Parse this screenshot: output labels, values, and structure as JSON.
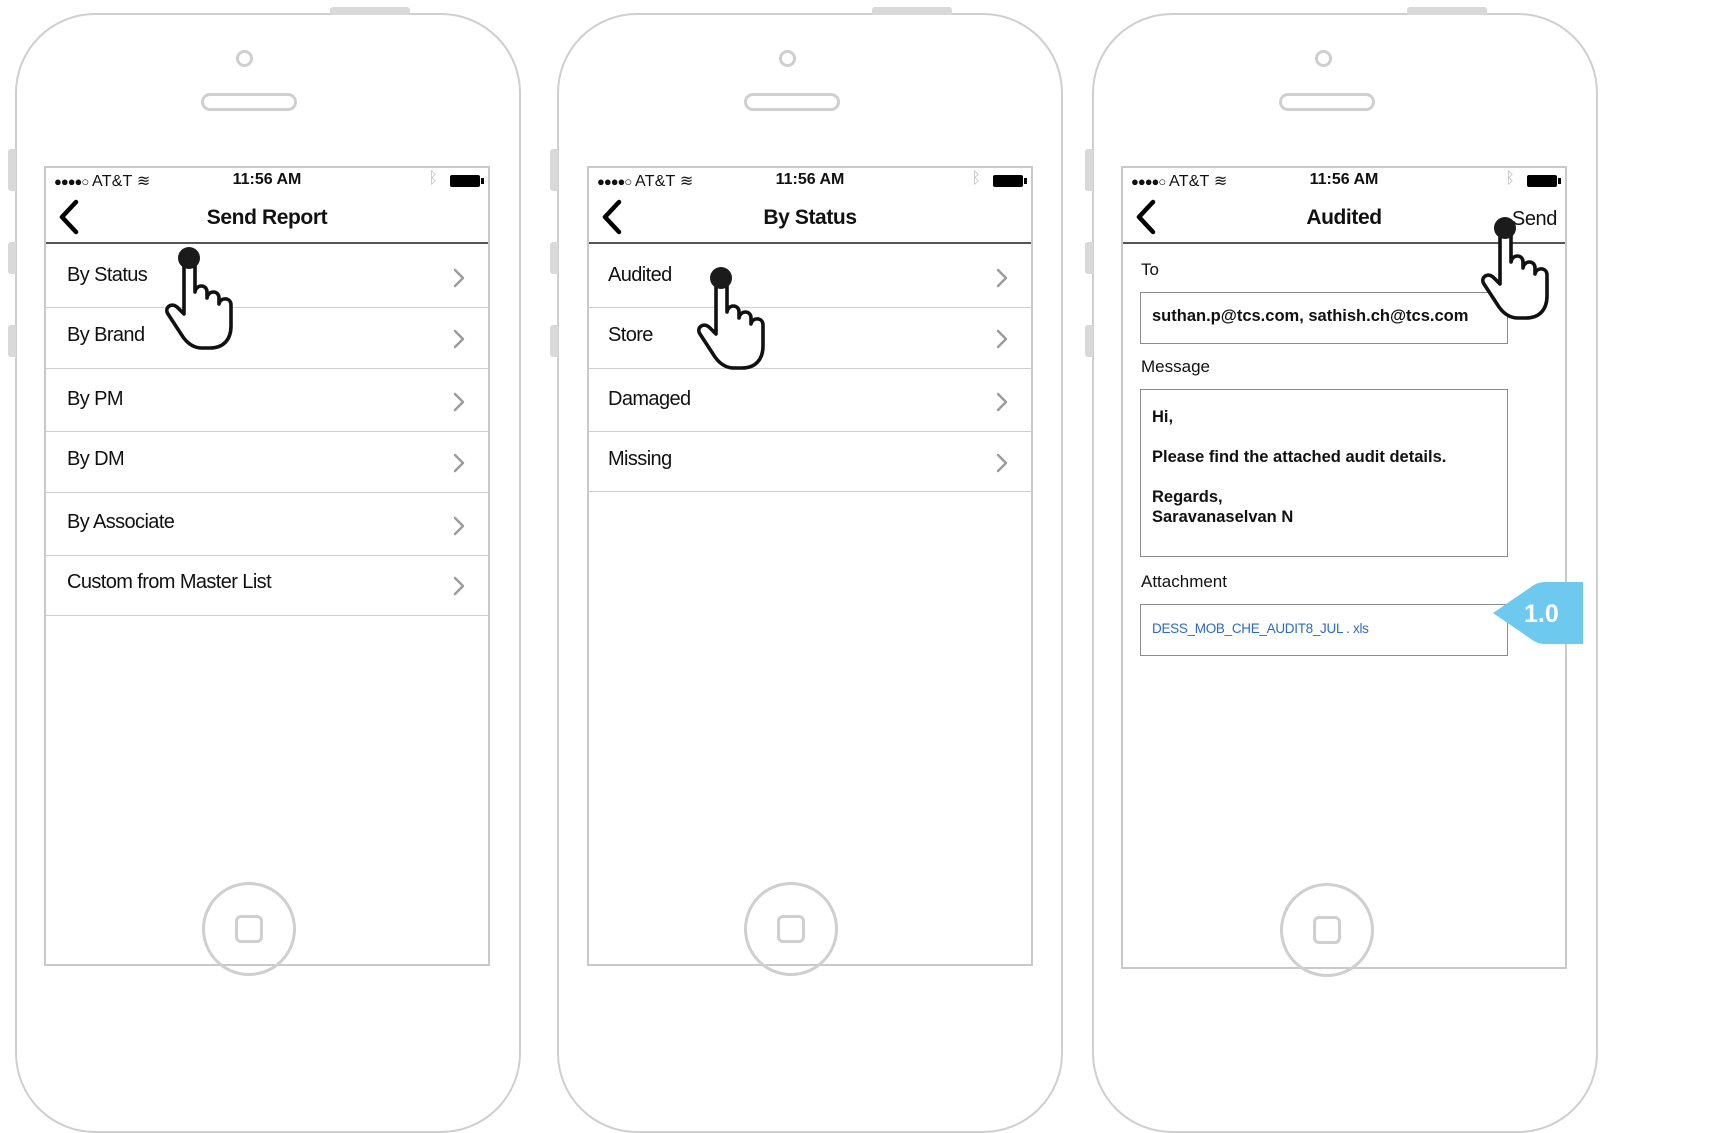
{
  "status_bar": {
    "signal": "●●●●○",
    "carrier": "AT&T",
    "time": "11:56 AM",
    "bluetooth": "ᛒ"
  },
  "screens": [
    {
      "title": "Send Report",
      "rows": [
        "By Status",
        "By Brand",
        "By PM",
        "By DM",
        "By Associate",
        "Custom from Master List"
      ]
    },
    {
      "title": "By Status",
      "rows": [
        "Audited",
        "Store",
        "Damaged",
        "Missing"
      ]
    },
    {
      "title": "Audited",
      "action": "Send",
      "to_label": "To",
      "to_value": "suthan.p@tcs.com, sathish.ch@tcs.com",
      "message_label": "Message",
      "message_lines": [
        "Hi,",
        "Please find the attached audit details.",
        "Regards,",
        "Saravanaselvan N"
      ],
      "attachment_label": "Attachment",
      "attachment_file": "DESS_MOB_CHE_AUDIT8_JUL . xls"
    }
  ],
  "annotation": {
    "label": "1.0",
    "color": "#6ec9ef"
  }
}
